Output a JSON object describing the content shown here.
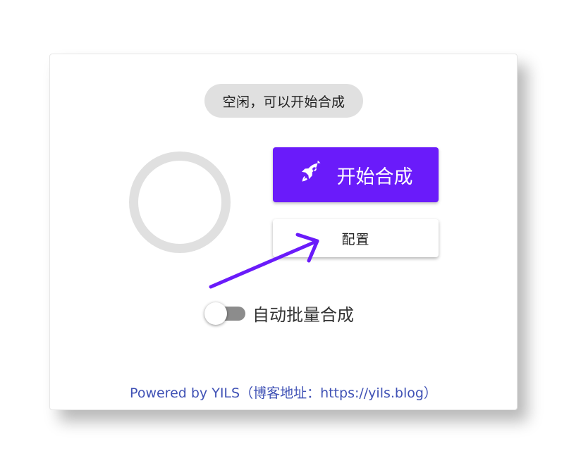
{
  "status": {
    "text": "空闲，可以开始合成"
  },
  "actions": {
    "start_label": "开始合成",
    "start_icon": "rocket-icon",
    "config_label": "配置"
  },
  "options": {
    "auto_batch_label": "自动批量合成",
    "auto_batch_enabled": false
  },
  "footer": {
    "text": "Powered by YILS（博客地址：https://yils.blog）"
  },
  "colors": {
    "accent": "#6a1bfa",
    "link": "#3f51b5",
    "status_bg": "#e0e0e0",
    "toggle_off": "#8c8c8c"
  }
}
